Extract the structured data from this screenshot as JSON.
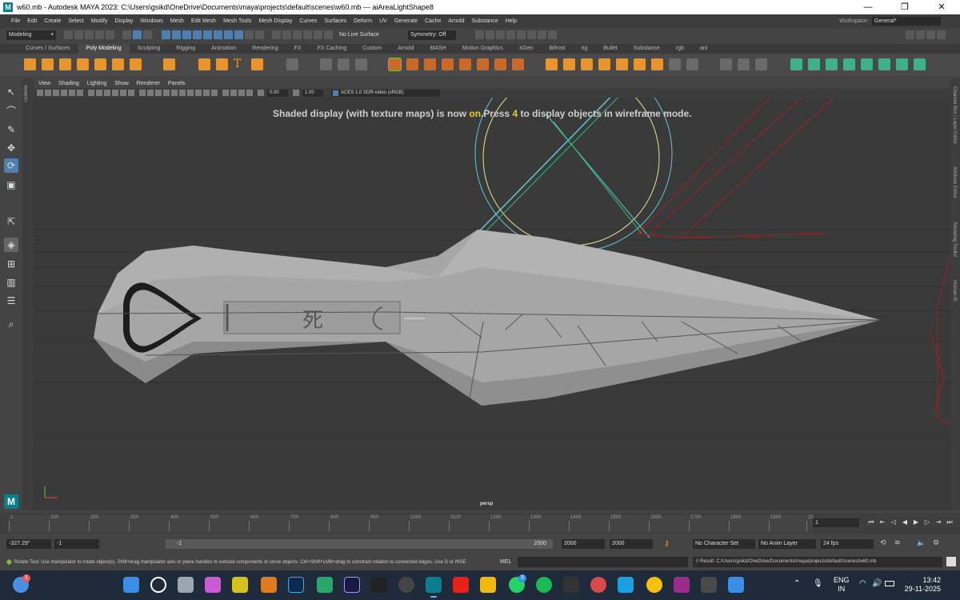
{
  "window": {
    "title": "w60.mb - Autodesk MAYA 2023: C:\\Users\\gsikd\\OneDrive\\Documents\\maya\\projects\\default\\scenes\\w60.mb  ---  aiAreaLightShape8"
  },
  "menubar": {
    "items": [
      "File",
      "Edit",
      "Create",
      "Select",
      "Modify",
      "Display",
      "Windows",
      "Mesh",
      "Edit Mesh",
      "Mesh Tools",
      "Mesh Display",
      "Curves",
      "Surfaces",
      "Deform",
      "UV",
      "Generate",
      "Cache",
      "Arnold",
      "Substance",
      "Help"
    ],
    "workspace_label": "Workspace:",
    "workspace_value": "General*"
  },
  "statusline": {
    "menuset": "Modeling",
    "live_surface": "No Live Surface",
    "symmetry": "Symmetry: Off"
  },
  "shelf": {
    "tabs": [
      "Curves / Surfaces",
      "Poly Modeling",
      "Sculpting",
      "Rigging",
      "Animation",
      "Rendering",
      "FX",
      "FX Caching",
      "Custom",
      "Arnold",
      "MASH",
      "Motion Graphics",
      "XGen",
      "Bifrost",
      "rig",
      "Bullet",
      "Substance",
      "rgb",
      "ani"
    ],
    "active_tab": 1
  },
  "panel": {
    "menus": [
      "View",
      "Shading",
      "Lighting",
      "Show",
      "Renderer",
      "Panels"
    ],
    "exposure": "0.00",
    "gamma": "1.00",
    "colorspace": "ACES 1.0 SDR-video (sRGB)",
    "camera": "persp",
    "hud": {
      "pre": "Shaded display (with texture maps) is now ",
      "on": "on",
      "mid": ".Press ",
      "key": "4",
      "post": " to display objects in wireframe mode."
    },
    "kanji": "死"
  },
  "side_panels": {
    "left": "Outliner",
    "right": [
      "Channel Box / Layer Editor",
      "Attribute Editor",
      "Modeling Toolkit",
      "Human IK"
    ]
  },
  "timeslider": {
    "ticks": [
      "1",
      "100",
      "200",
      "300",
      "400",
      "500",
      "600",
      "700",
      "800",
      "900",
      "1000",
      "1100",
      "1200",
      "1300",
      "1400",
      "1500",
      "1600",
      "1700",
      "1800",
      "1900",
      "20"
    ],
    "current_frame": "1"
  },
  "rangeslider": {
    "playback_start": "-327.29°",
    "anim_start": "-1",
    "range_start": "-1",
    "range_end": "2000",
    "playback_end": "2000",
    "anim_end": "2000",
    "character_set": "No Character Set",
    "anim_layer": "No Anim Layer",
    "fps": "24 fps"
  },
  "commandline": {
    "help": "Rotate Tool: Use manipulator to rotate object(s). Shift+drag manipulator axis or plane handles to extrude components or clone objects. Ctrl+Shift+LMB+drag to constrain rotation to connected edges. Use D or INSE",
    "language": "MEL",
    "result": "// Result: C:/Users/gsikd/OneDrive/Documents/maya/projects/default/scenes/w60.mb"
  },
  "taskbar": {
    "lang_top": "ENG",
    "lang_bottom": "IN",
    "time": "13:42",
    "date": "29-11-2025",
    "badge_left": "1",
    "badge_whatsapp": "3"
  },
  "colors": {
    "accent": "#4f7fae",
    "highlight": "#f0d000",
    "viewport": "#3a3a3a",
    "kunai": "#a6a6a6"
  }
}
